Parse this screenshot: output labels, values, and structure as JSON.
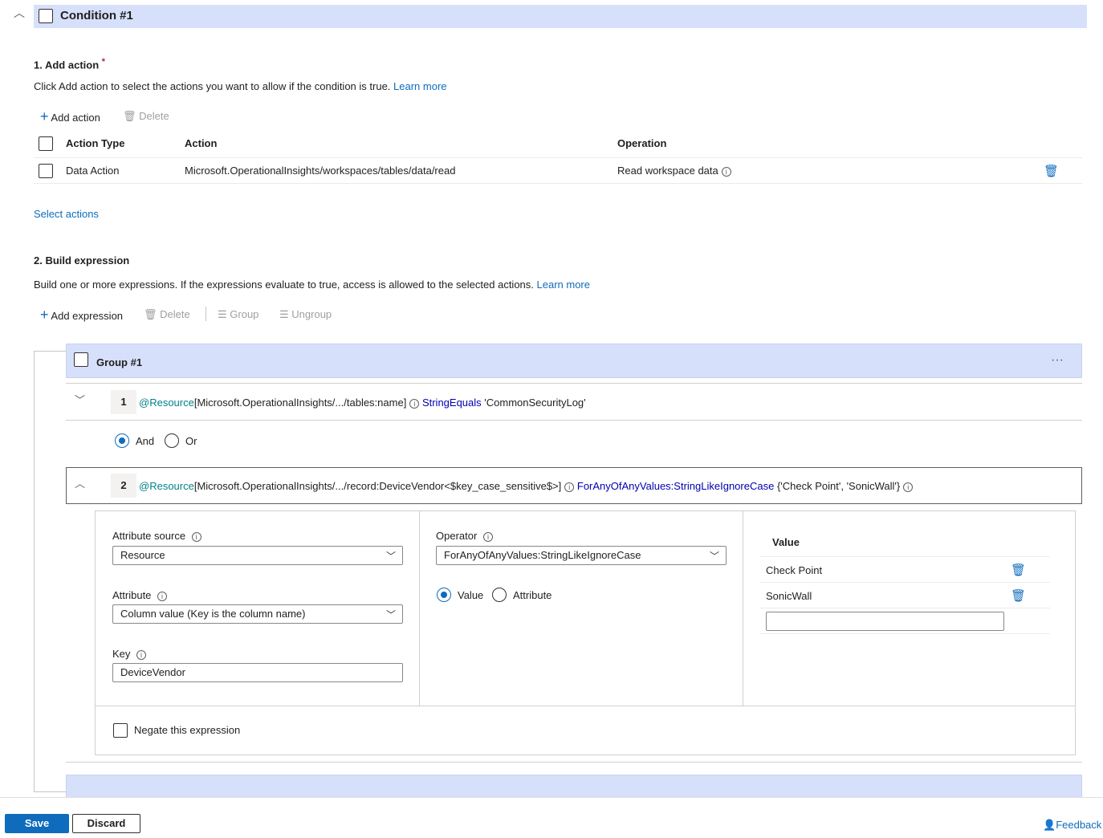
{
  "condition": {
    "title": "Condition #1"
  },
  "section1": {
    "title": "1. Add action",
    "required": "*",
    "description": "Click Add action to select the actions you want to allow if the condition is true.",
    "learn_more": "Learn more",
    "add_label": "Add action",
    "delete_label": "Delete",
    "columns": [
      "Action Type",
      "Action",
      "Operation"
    ],
    "rows": [
      {
        "type": "Data Action",
        "action": "Microsoft.OperationalInsights/workspaces/tables/data/read",
        "operation": "Read workspace data"
      }
    ],
    "select_actions": "Select actions"
  },
  "section2": {
    "title": "2. Build expression",
    "description": "Build one or more expressions. If the expressions evaluate to true, access is allowed to the selected actions.",
    "learn_more": "Learn more",
    "add_label": "Add expression",
    "delete_label": "Delete",
    "group_label": "Group",
    "ungroup_label": "Ungroup"
  },
  "group": {
    "title": "Group #1",
    "more": "···"
  },
  "expr1": {
    "num": "1",
    "source": "@Resource",
    "attr": "[Microsoft.OperationalInsights/.../tables:name]",
    "op": "StringEquals",
    "value": "'CommonSecurityLog'"
  },
  "logic": {
    "and": "And",
    "or": "Or"
  },
  "expr2": {
    "num": "2",
    "source": "@Resource",
    "attr": "[Microsoft.OperationalInsights/.../record:DeviceVendor<$key_case_sensitive$>]",
    "op": "ForAnyOfAnyValues:StringLikeIgnoreCase",
    "value": "{'Check Point', 'SonicWall'}"
  },
  "editor": {
    "attr_source_label": "Attribute source",
    "attr_source": "Resource",
    "attribute_label": "Attribute",
    "attribute": "Column value (Key is the column name)",
    "key_label": "Key",
    "key": "DeviceVendor",
    "operator_label": "Operator",
    "operator": "ForAnyOfAnyValues:StringLikeIgnoreCase",
    "value_radio": "Value",
    "attribute_radio": "Attribute",
    "value_header": "Value",
    "values": [
      "Check Point",
      "SonicWall"
    ],
    "negate": "Negate this expression"
  },
  "footer": {
    "save": "Save",
    "discard": "Discard",
    "feedback": "Feedback"
  }
}
